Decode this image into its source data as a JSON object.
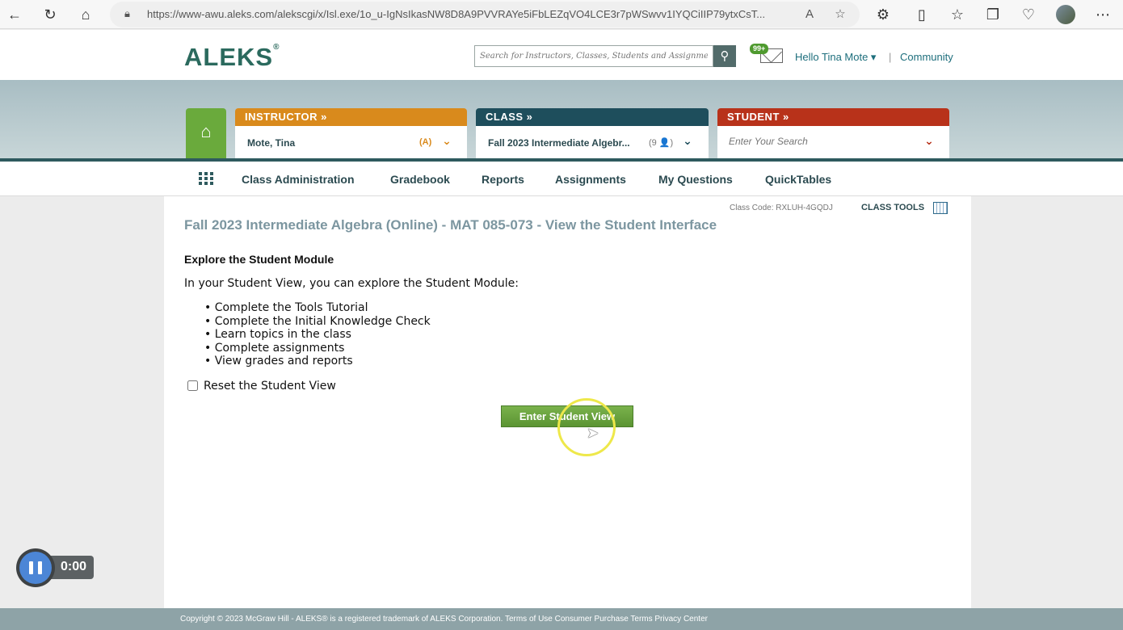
{
  "browser": {
    "url": "https://www-awu.aleks.com/alekscgi/x/Isl.exe/1o_u-IgNsIkasNW8D8A9PVVRAYe5iFbLEZqVO4LCE3r7pWSwvv1IYQCiIIP79ytxCsT..."
  },
  "header": {
    "logo": "ALEKS",
    "search_placeholder": "Search for Instructors, Classes, Students and Assignments",
    "mail_badge": "99+",
    "hello": "Hello Tina Mote ▾",
    "separator": "|",
    "community": "Community"
  },
  "tabs": {
    "instructor": {
      "label": "INSTRUCTOR »",
      "value": "Mote, Tina",
      "extra": "(A)"
    },
    "class": {
      "label": "CLASS »",
      "value": "Fall 2023 Intermediate Algebr...",
      "extra": "(9 👤)"
    },
    "student": {
      "label": "STUDENT »",
      "placeholder": "Enter Your Search"
    }
  },
  "nav": {
    "items": [
      "Class Administration",
      "Gradebook",
      "Reports",
      "Assignments",
      "My Questions",
      "QuickTables"
    ]
  },
  "content": {
    "class_code": "Class Code: RXLUH-4GQDJ",
    "class_tools": "CLASS TOOLS",
    "title": "Fall 2023 Intermediate Algebra (Online) - MAT 085-073 - View the Student Interface",
    "section_heading": "Explore the Student Module",
    "intro": "In your Student View, you can explore the Student Module:",
    "bullets": [
      "Complete the Tools Tutorial",
      "Complete the Initial Knowledge Check",
      "Learn topics in the class",
      "Complete assignments",
      "View grades and reports"
    ],
    "reset_label": "Reset the Student View",
    "enter_button": "Enter Student View"
  },
  "footer": {
    "text": "Copyright © 2023 McGraw Hill - ALEKS® is a registered trademark of ALEKS Corporation. Terms of Use Consumer Purchase Terms Privacy Center"
  },
  "recorder": {
    "time": "0:00"
  },
  "colors": {
    "instructor_tab": "#d98a1c",
    "class_tab": "#1e4e5c",
    "student_tab": "#b8321a",
    "home_tab": "#6aaa3c",
    "button": "#6aa53e"
  }
}
